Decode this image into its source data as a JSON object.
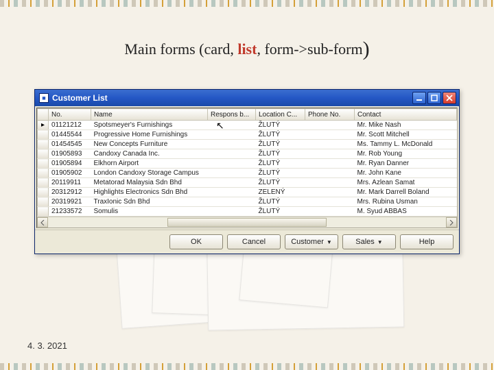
{
  "slide": {
    "title_pre": "Main forms (card, ",
    "title_hl": "list",
    "title_post": ", form->sub-form",
    "title_paren": ")",
    "footer_date": "4. 3. 2021"
  },
  "window": {
    "title": "Customer List",
    "min_icon": "minimize-icon",
    "max_icon": "maximize-icon",
    "close_icon": "close-icon"
  },
  "columns": {
    "sel": "",
    "no": "No.",
    "name": "Name",
    "resp": "Respons b...",
    "loc": "Location C...",
    "phone": "Phone No.",
    "contact": "Contact"
  },
  "rows": [
    {
      "no": "01121212",
      "name": "Spotsmeyer's Furnishings",
      "loc": "ŽLUTÝ",
      "contact": "Mr. Mike Nash"
    },
    {
      "no": "01445544",
      "name": "Progressive Home Furnishings",
      "loc": "ŽLUTÝ",
      "contact": "Mr. Scott Mitchell"
    },
    {
      "no": "01454545",
      "name": "New Concepts Furniture",
      "loc": "ŽLUTÝ",
      "contact": "Ms. Tammy L. McDonald"
    },
    {
      "no": "01905893",
      "name": "Candoxy Canada Inc.",
      "loc": "ŽLUTÝ",
      "contact": "Mr. Rob Young"
    },
    {
      "no": "01905894",
      "name": "Elkhorn Airport",
      "loc": "ŽLUTÝ",
      "contact": "Mr. Ryan Danner"
    },
    {
      "no": "01905902",
      "name": "London Candoxy Storage Campus",
      "loc": "ŽLUTÝ",
      "contact": "Mr. John Kane"
    },
    {
      "no": "20119911",
      "name": "Metatorad Malaysia Sdn Bhd",
      "loc": "ŽLUTÝ",
      "contact": "Mrs. Azlean Samat"
    },
    {
      "no": "20312912",
      "name": "Highlights Electronics Sdn Bhd",
      "loc": "ZELENÝ",
      "contact": "Mr. Mark Darrell Boland"
    },
    {
      "no": "20319921",
      "name": "TraxIonic Sdn Bhd",
      "loc": "ŽLUTÝ",
      "contact": "Mrs. Rubina Usman"
    },
    {
      "no": "21233572",
      "name": "Somulis",
      "loc": "ŽLUTÝ",
      "contact": "M. Syud ABBAS"
    }
  ],
  "buttons": {
    "ok": "OK",
    "cancel": "Cancel",
    "customer": "Customer",
    "sales": "Sales",
    "help": "Help"
  }
}
